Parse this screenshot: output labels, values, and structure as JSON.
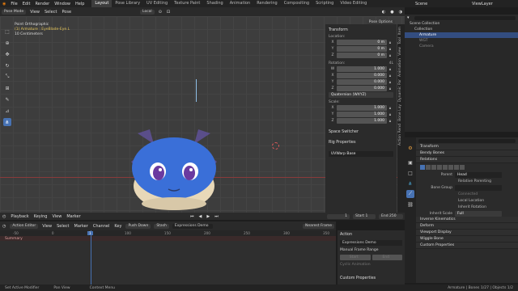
{
  "topbar": {
    "menus": [
      "File",
      "Edit",
      "Render",
      "Window",
      "Help"
    ],
    "workspaces": [
      "Layout",
      "Pose Library",
      "UV Editing",
      "Texture Paint",
      "Shading",
      "Animation",
      "Rendering",
      "Compositing",
      "Scripting",
      "Video Editing"
    ],
    "active_workspace": "Layout",
    "scene": "Scene",
    "view_layer": "ViewLayer"
  },
  "viewport_header": {
    "mode": "Pose Mode",
    "menus": [
      "View",
      "Select",
      "Pose"
    ],
    "orientation": "Local"
  },
  "viewport": {
    "info_line1": "Point Orthographic",
    "info_line2": "(1) Armature : EyeBlade-Eye.L",
    "info_line3": "10 Centimeters",
    "pose_options": "Pose Options"
  },
  "npanel": {
    "transform_label": "Transform",
    "location_label": "Location:",
    "location": [
      {
        "axis": "X",
        "value": "0 m"
      },
      {
        "axis": "Y",
        "value": "0 m"
      },
      {
        "axis": "Z",
        "value": "0 m"
      }
    ],
    "rotation_label": "Rotation:",
    "rotation_mode_value": "4L",
    "rotation": [
      {
        "axis": "W",
        "value": "1.000"
      },
      {
        "axis": "X",
        "value": "0.000"
      },
      {
        "axis": "Y",
        "value": "0.000"
      },
      {
        "axis": "Z",
        "value": "0.000"
      }
    ],
    "rotation_mode": "Quaternion (WXYZ)",
    "scale_label": "Scale:",
    "scale": [
      {
        "axis": "X",
        "value": "1.000"
      },
      {
        "axis": "Y",
        "value": "1.000"
      },
      {
        "axis": "Z",
        "value": "1.000"
      }
    ],
    "space_switcher": "Space Switcher",
    "rig_properties": "Rig Properties",
    "uvwarp": "UVWarp Base",
    "side_tabs": [
      "Item",
      "Tool",
      "View",
      "Animation",
      "Dynamic Par",
      "Bone Lay",
      "Action Rend",
      "Bone Dynamic",
      "Simplicity",
      "Bone Dynamic",
      "Pose Li"
    ]
  },
  "outliner": {
    "rows": [
      {
        "label": "Scene Collection",
        "indent": 0,
        "selected": false
      },
      {
        "label": "Collection",
        "indent": 1,
        "selected": false
      },
      {
        "label": "Armature",
        "indent": 2,
        "selected": true
      },
      {
        "label": "WGT",
        "indent": 2,
        "selected": false
      },
      {
        "label": "Camera",
        "indent": 2,
        "selected": false
      }
    ]
  },
  "properties": {
    "sections": {
      "transform": "Transform",
      "bendy_bones": "Bendy Bones",
      "relations": "Relations",
      "parent_label": "Parent",
      "parent_value": "Head",
      "relative_parenting": "Relative Parenting",
      "bone_group_label": "Bone Group",
      "connected": "Connected",
      "local_location": "Local Location",
      "inherit_rotation": "Inherit Rotation",
      "inherit_scale_label": "Inherit Scale",
      "inherit_scale_value": "Full",
      "inverse_kinematics": "Inverse Kinematics",
      "deform": "Deform",
      "viewport_display": "Viewport Display",
      "wiggle_bone": "Wiggle Bone",
      "custom_properties": "Custom Properties"
    }
  },
  "timeline": {
    "menus": [
      "Playback",
      "Keying",
      "View",
      "Marker"
    ],
    "current_frame": "1",
    "start_label": "Start",
    "start": "1",
    "end_label": "End",
    "end": "250"
  },
  "dopesheet": {
    "editor": "Action Editor",
    "menus": [
      "View",
      "Select",
      "Marker",
      "Channel",
      "Key"
    ],
    "push_down": "Push Down",
    "stash": "Stash",
    "action_name": "Expressions Demo",
    "snap": "Nearest Frame",
    "channel": "Summary",
    "frames": [
      "0",
      "10",
      "20",
      "30",
      "40",
      "50",
      "60",
      "70",
      "80",
      "90",
      "100",
      "110",
      "120",
      "130",
      "140",
      "150",
      "160",
      "170"
    ],
    "ruler_numbers": [
      "-50",
      "0",
      "50",
      "100",
      "150",
      "200",
      "250",
      "300",
      "350"
    ],
    "current": "1"
  },
  "action_panel": {
    "title": "Action",
    "action_name": "Expressions Demo",
    "manual_frame_range": "Manual Frame Range",
    "start": "Start",
    "end": "End",
    "cyclic": "Cyclic Animation",
    "custom_properties": "Custom Properties"
  },
  "statusbar": {
    "left": "Set Active Modifier",
    "middle1": "Pan View",
    "middle2": "Context Menu",
    "right": "Armature | Bones 1/27 | Objects 1/2"
  },
  "colors": {
    "accent": "#4772b3",
    "selected_row": "#334d80",
    "creature_blue": "#3a6fd8",
    "horns": "#5a4e8a"
  }
}
